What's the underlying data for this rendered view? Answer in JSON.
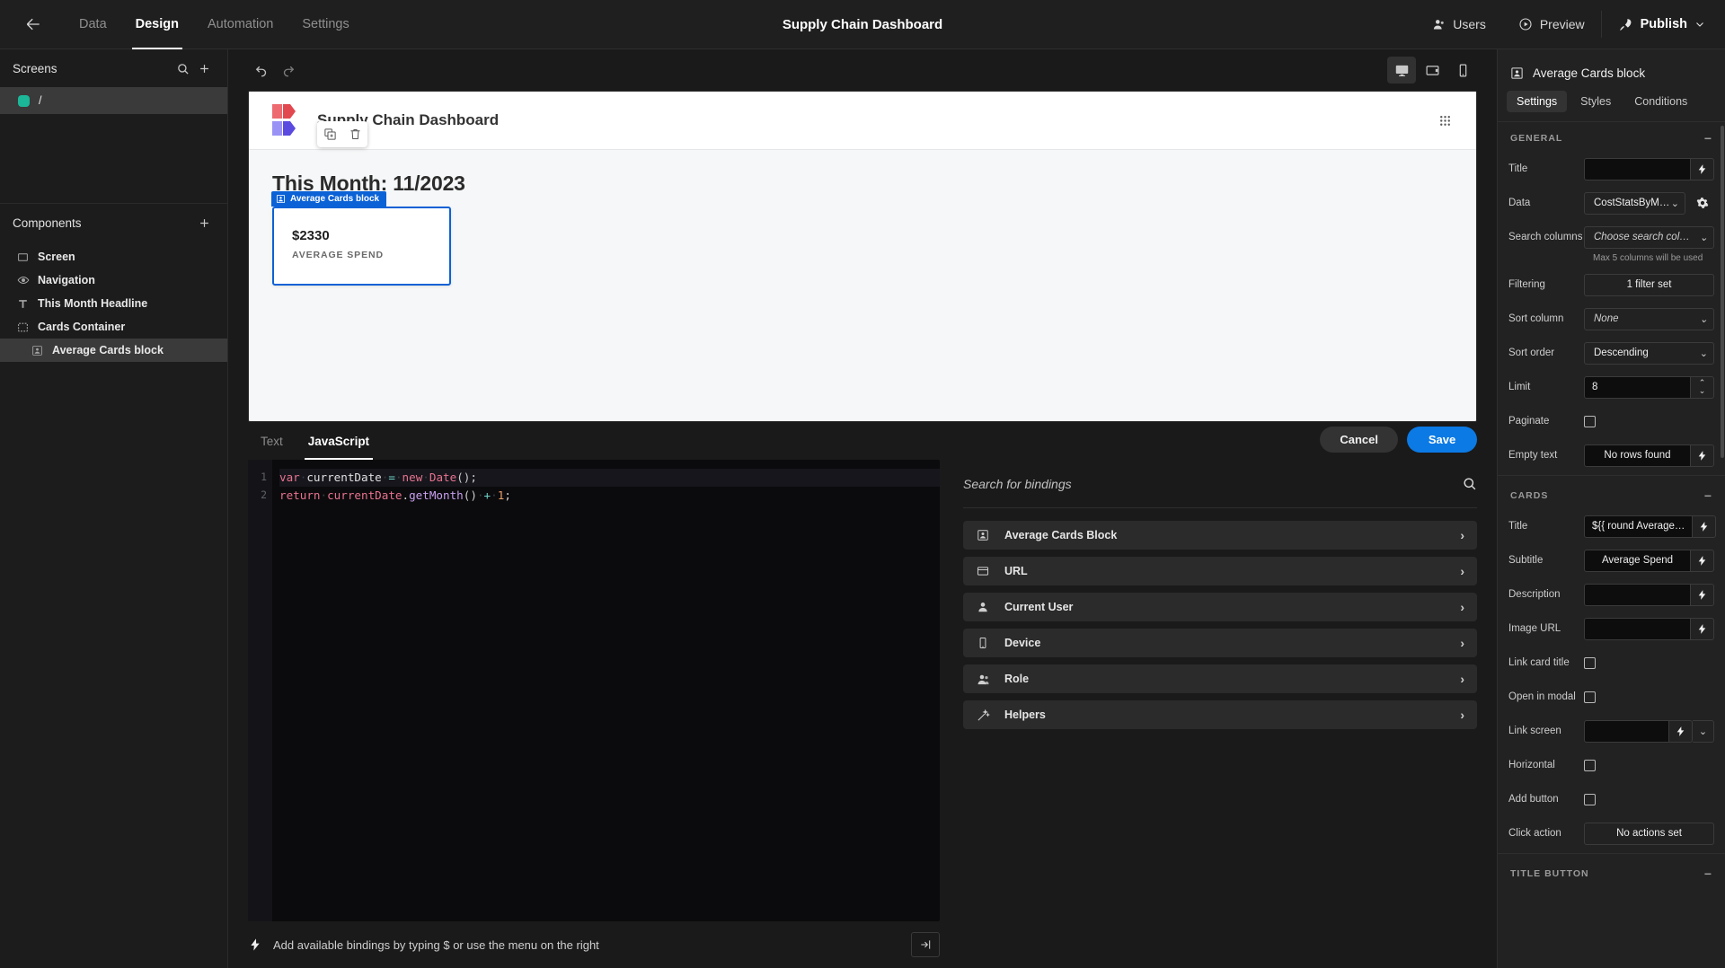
{
  "topbar": {
    "back_icon": "arrow-left-icon",
    "tabs": [
      {
        "label": "Data",
        "active": false
      },
      {
        "label": "Design",
        "active": true
      },
      {
        "label": "Automation",
        "active": false
      },
      {
        "label": "Settings",
        "active": false
      }
    ],
    "title": "Supply Chain Dashboard",
    "users_label": "Users",
    "preview_label": "Preview",
    "publish_label": "Publish"
  },
  "left_panel": {
    "screens_title": "Screens",
    "screens": [
      {
        "label": "/",
        "color": "#1cb698",
        "selected": true
      }
    ],
    "components_title": "Components",
    "components": [
      {
        "label": "Screen",
        "icon": "screen-icon",
        "indent": 0,
        "selected": false
      },
      {
        "label": "Navigation",
        "icon": "eye-icon",
        "indent": 0,
        "selected": false
      },
      {
        "label": "This Month Headline",
        "icon": "text-icon",
        "indent": 0,
        "selected": false
      },
      {
        "label": "Cards Container",
        "icon": "container-icon",
        "indent": 0,
        "selected": false
      },
      {
        "label": "Average Cards block",
        "icon": "card-block-icon",
        "indent": 1,
        "selected": true
      }
    ]
  },
  "canvas": {
    "devices": [
      {
        "name": "desktop",
        "active": true
      },
      {
        "name": "tablet",
        "active": false
      },
      {
        "name": "mobile",
        "active": false
      }
    ],
    "app_title": "Supply Chain Dashboard",
    "headline": "This Month: 11/2023",
    "selection_label": "Average Cards block",
    "card": {
      "value": "$2330",
      "subtitle": "AVERAGE SPEND"
    },
    "float_actions": [
      "duplicate-icon",
      "delete-icon"
    ]
  },
  "editor": {
    "tabs": [
      {
        "label": "Text",
        "active": false
      },
      {
        "label": "JavaScript",
        "active": true
      }
    ],
    "cancel_label": "Cancel",
    "save_label": "Save",
    "line_numbers": [
      "1",
      "2"
    ],
    "code": [
      "var currentDate = new Date();",
      "return currentDate.getMonth() + 1;"
    ],
    "hint": "Add available bindings by typing $ or use the menu on the right",
    "bindings": {
      "search_placeholder": "Search for bindings",
      "items": [
        {
          "label": "Average Cards Block",
          "icon": "card-block-icon"
        },
        {
          "label": "URL",
          "icon": "browser-icon"
        },
        {
          "label": "Current User",
          "icon": "user-icon"
        },
        {
          "label": "Device",
          "icon": "mobile-icon"
        },
        {
          "label": "Role",
          "icon": "users-icon"
        },
        {
          "label": "Helpers",
          "icon": "wand-icon"
        }
      ]
    }
  },
  "right_panel": {
    "header_title": "Average Cards block",
    "tabs": [
      {
        "label": "Settings",
        "active": true
      },
      {
        "label": "Styles",
        "active": false
      },
      {
        "label": "Conditions",
        "active": false
      }
    ],
    "general": {
      "title": "GENERAL",
      "fields": {
        "title_label": "Title",
        "title_value": "",
        "data_label": "Data",
        "data_value": "CostStatsByM…",
        "search_columns_label": "Search columns",
        "search_columns_placeholder": "Choose search col…",
        "search_columns_hint": "Max 5 columns will be used",
        "filtering_label": "Filtering",
        "filtering_value": "1 filter set",
        "sort_column_label": "Sort column",
        "sort_column_value": "None",
        "sort_order_label": "Sort order",
        "sort_order_value": "Descending",
        "limit_label": "Limit",
        "limit_value": "8",
        "paginate_label": "Paginate",
        "paginate_checked": false,
        "empty_text_label": "Empty text",
        "empty_text_value": "No rows found"
      }
    },
    "cards": {
      "title": "CARDS",
      "fields": {
        "title_label": "Title",
        "title_value": "${{ round Average…",
        "subtitle_label": "Subtitle",
        "subtitle_value": "Average Spend",
        "description_label": "Description",
        "description_value": "",
        "image_url_label": "Image URL",
        "image_url_value": "",
        "link_card_title_label": "Link card title",
        "link_card_title_checked": false,
        "open_in_modal_label": "Open in modal",
        "open_in_modal_checked": false,
        "link_screen_label": "Link screen",
        "link_screen_value": "",
        "horizontal_label": "Horizontal",
        "horizontal_checked": false,
        "add_button_label": "Add button",
        "add_button_checked": false,
        "click_action_label": "Click action",
        "click_action_value": "No actions set"
      }
    },
    "title_button": {
      "title": "TITLE BUTTON"
    }
  },
  "colors": {
    "accent_blue": "#0b7ae5",
    "selection_blue": "#0b62d6",
    "screen_green": "#1cb698"
  }
}
